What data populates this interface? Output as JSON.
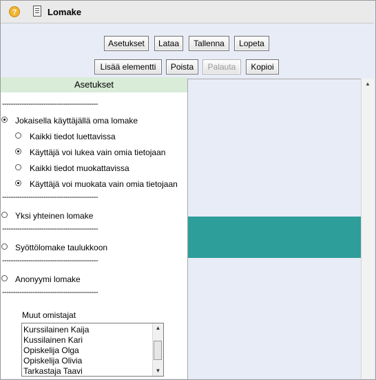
{
  "window": {
    "title": "Lomake",
    "icons": [
      "help-icon",
      "form-icon"
    ],
    "help_glyph": "?"
  },
  "toolbar": {
    "row1": [
      "Asetukset",
      "Lataa",
      "Tallenna",
      "Lopeta"
    ],
    "row2": [
      "Lisää elementti",
      "Poista",
      "Palauta",
      "Kopioi"
    ],
    "disabled": [
      "Palauta"
    ]
  },
  "settings": {
    "header": "Asetukset",
    "separator": "--------------------------------------------",
    "mode_options": [
      {
        "label": "Jokaisella käyttäjällä oma lomake",
        "selected": true
      },
      {
        "label": "Yksi yhteinen lomake",
        "selected": false
      },
      {
        "label": "Syöttölomake taulukkoon",
        "selected": false
      },
      {
        "label": "Anonyymi lomake",
        "selected": false
      }
    ],
    "sub_options": [
      {
        "label": "Kaikki tiedot luettavissa",
        "selected": false
      },
      {
        "label": "Käyttäjä voi lukea vain omia tietojaan",
        "selected": true
      },
      {
        "label": "Kaikki tiedot muokattavissa",
        "selected": false
      },
      {
        "label": "Käyttäjä voi muokata vain omia tietojaan",
        "selected": true
      }
    ],
    "owners_label": "Muut omistajat",
    "owners": [
      "Kurssilainen Kaija",
      "Kussilainen Kari",
      "Opiskelija Olga",
      "Opiskelija Olivia",
      "Tarkastaja Taavi"
    ]
  },
  "canvas": {
    "highlight_color": "#2e9e9a"
  }
}
